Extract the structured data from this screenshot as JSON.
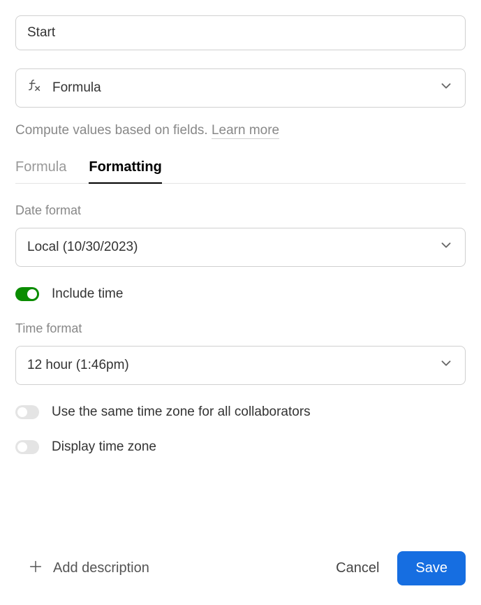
{
  "name_input": {
    "value": "Start"
  },
  "type_select": {
    "label": "Formula"
  },
  "description": {
    "text": "Compute values based on fields.",
    "learn_more": "Learn more"
  },
  "tabs": {
    "formula": "Formula",
    "formatting": "Formatting"
  },
  "date_format": {
    "label": "Date format",
    "value": "Local (10/30/2023)"
  },
  "include_time": {
    "label": "Include time"
  },
  "time_format": {
    "label": "Time format",
    "value": "12 hour (1:46pm)"
  },
  "same_tz": {
    "label": "Use the same time zone for all collaborators"
  },
  "display_tz": {
    "label": "Display time zone"
  },
  "footer": {
    "add_description": "Add description",
    "cancel": "Cancel",
    "save": "Save"
  }
}
